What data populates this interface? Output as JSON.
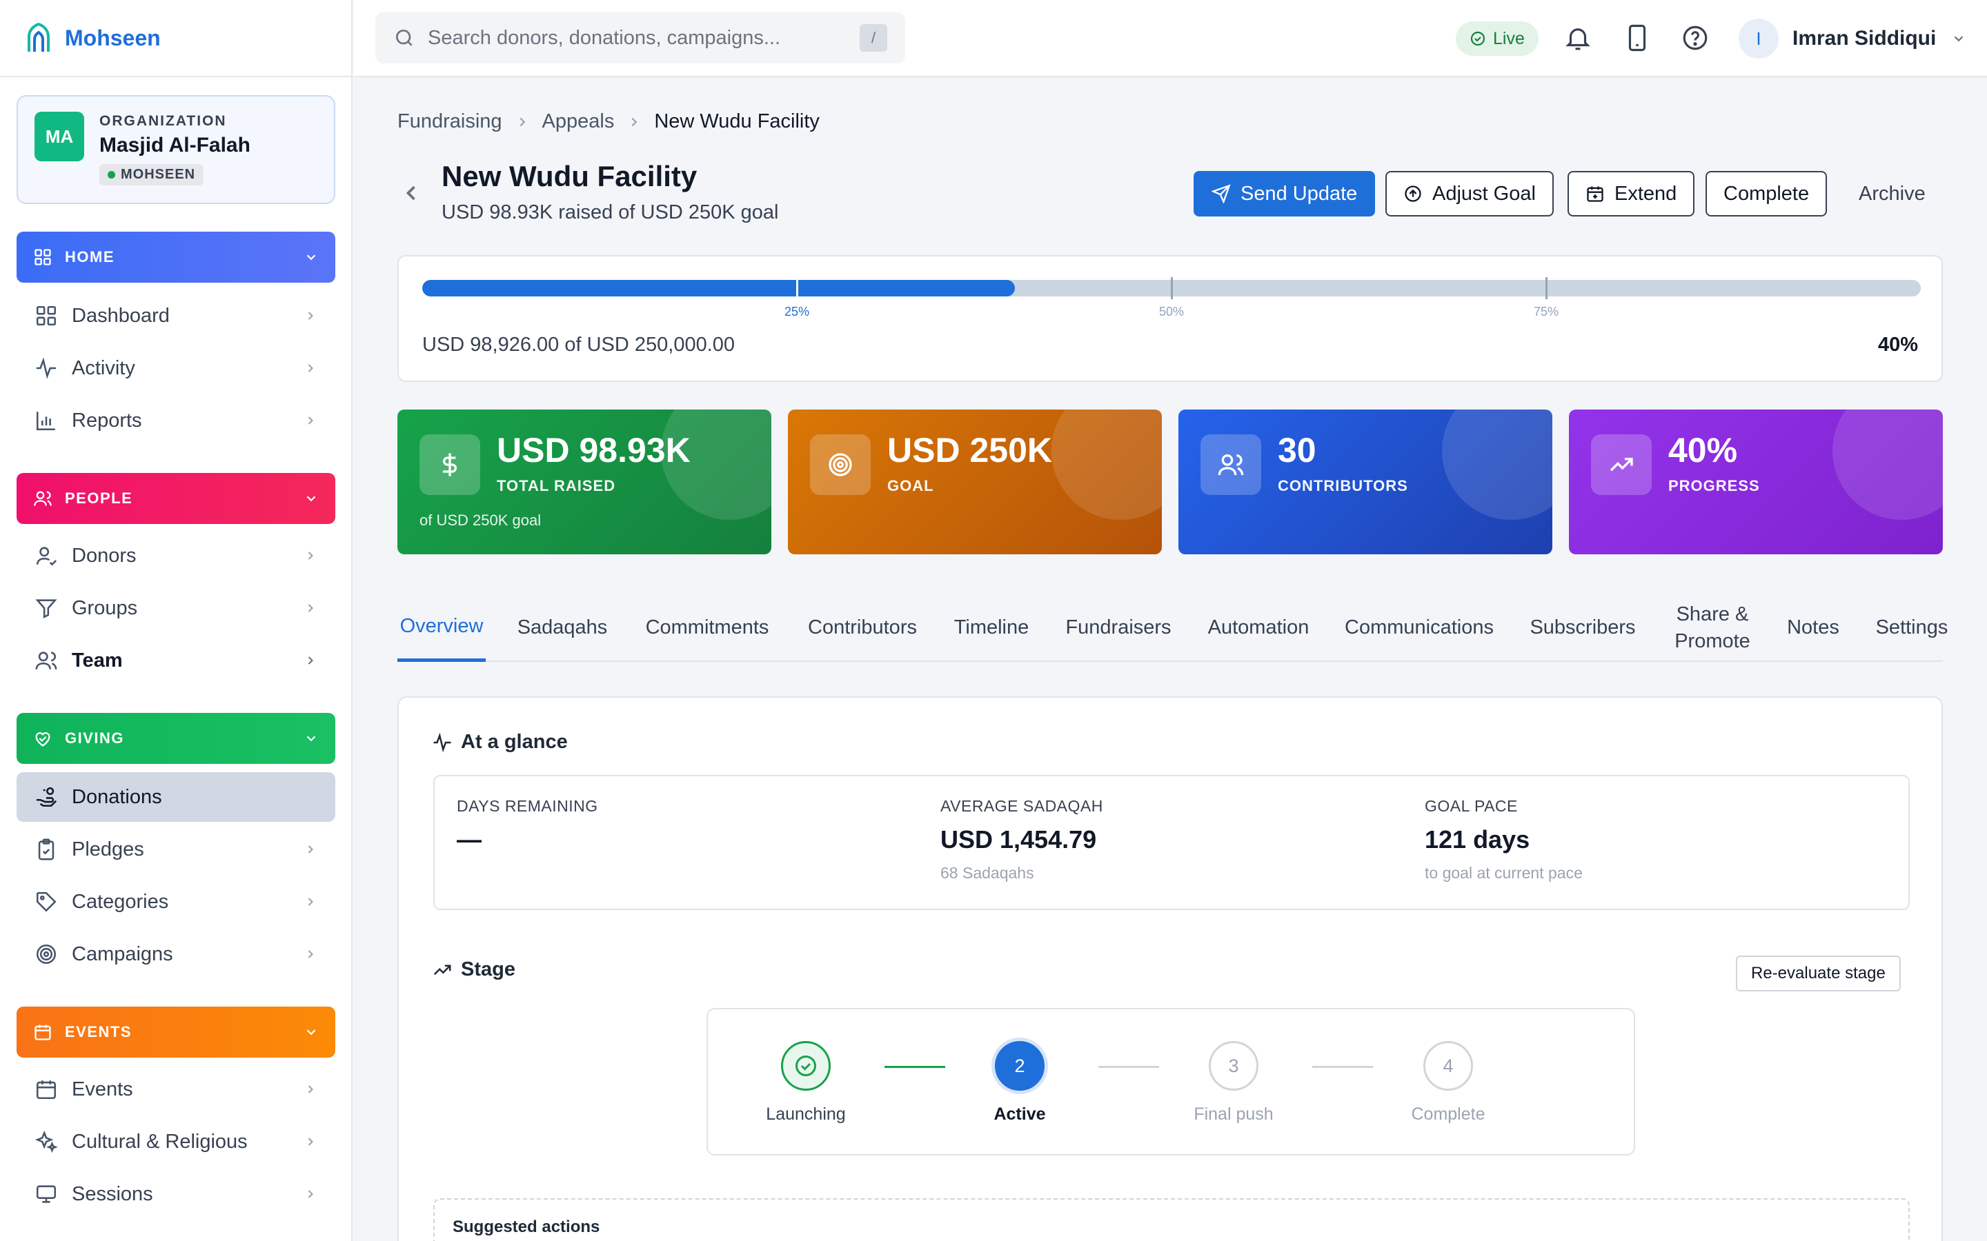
{
  "brand": {
    "name": "Mohseen"
  },
  "org": {
    "initials": "MA",
    "label": "ORGANIZATION",
    "name": "Masjid Al-Falah",
    "badge": "MOHSEEN"
  },
  "sidebar": {
    "home": {
      "label": "HOME",
      "color": "#4f6ef7",
      "items": [
        {
          "label": "Dashboard",
          "icon": "dashboard-icon"
        },
        {
          "label": "Activity",
          "icon": "activity-icon"
        },
        {
          "label": "Reports",
          "icon": "bar-chart-icon"
        }
      ]
    },
    "people": {
      "label": "PEOPLE",
      "color": "#f0106c",
      "items": [
        {
          "label": "Donors",
          "icon": "user-icon"
        },
        {
          "label": "Groups",
          "icon": "filter-icon"
        },
        {
          "label": "Team",
          "icon": "users-icon"
        }
      ]
    },
    "giving": {
      "label": "GIVING",
      "color": "#16b35a",
      "items": [
        {
          "label": "Donations",
          "icon": "hand-coins-icon"
        },
        {
          "label": "Pledges",
          "icon": "clipboard-icon"
        },
        {
          "label": "Categories",
          "icon": "tag-icon"
        },
        {
          "label": "Campaigns",
          "icon": "target-icon"
        }
      ]
    },
    "events": {
      "label": "EVENTS",
      "color": "#fb7a06",
      "items": [
        {
          "label": "Events",
          "icon": "calendar-icon"
        },
        {
          "label": "Cultural & Religious",
          "icon": "sparkles-icon"
        },
        {
          "label": "Sessions",
          "icon": "monitor-icon"
        }
      ]
    }
  },
  "topbar": {
    "search_placeholder": "Search donors, donations, campaigns...",
    "search_shortcut": "/",
    "live_label": "Live",
    "user_initial": "I",
    "user_name": "Imran Siddiqui"
  },
  "breadcrumb": [
    "Fundraising",
    "Appeals",
    "New Wudu Facility"
  ],
  "page": {
    "title": "New Wudu Facility",
    "subtitle": "USD 98.93K raised of USD 250K goal",
    "actions": {
      "send_update": "Send Update",
      "adjust_goal": "Adjust Goal",
      "extend": "Extend",
      "complete": "Complete",
      "archive": "Archive"
    }
  },
  "progress": {
    "fraction": 0.3957,
    "milestones": [
      "25%",
      "50%",
      "75%"
    ],
    "text": "USD 98,926.00 of USD 250,000.00",
    "percent_label": "40%"
  },
  "stats": [
    {
      "value": "USD 98.93K",
      "label": "TOTAL RAISED",
      "note": "of USD 250K goal",
      "icon": "dollar-icon",
      "color_from": "#16a34a",
      "color_to": "#15803d"
    },
    {
      "value": "USD 250K",
      "label": "GOAL",
      "note": "",
      "icon": "target-icon",
      "color_from": "#d97706",
      "color_to": "#b45309"
    },
    {
      "value": "30",
      "label": "CONTRIBUTORS",
      "note": "",
      "icon": "users-icon",
      "color_from": "#2563eb",
      "color_to": "#1e40af"
    },
    {
      "value": "40%",
      "label": "PROGRESS",
      "note": "",
      "icon": "trending-up-icon",
      "color_from": "#9333ea",
      "color_to": "#7e22ce"
    }
  ],
  "tabs": [
    "Overview",
    "Sadaqahs",
    "Commitments",
    "Contributors",
    "Timeline",
    "Fundraisers",
    "Automation",
    "Communications",
    "Subscribers",
    "Share & Promote",
    "Notes",
    "Settings"
  ],
  "glance": {
    "title": "At a glance",
    "cells": [
      {
        "label": "DAYS REMAINING",
        "value": "—",
        "sub": ""
      },
      {
        "label": "AVERAGE SADAQAH",
        "value": "USD 1,454.79",
        "sub": "68 Sadaqahs"
      },
      {
        "label": "GOAL PACE",
        "value": "121 days",
        "sub": "to goal at current pace"
      }
    ]
  },
  "stage": {
    "title": "Stage",
    "reevaluate": "Re-evaluate stage",
    "steps": [
      {
        "num": "1",
        "label": "Launching",
        "state": "done"
      },
      {
        "num": "2",
        "label": "Active",
        "state": "current"
      },
      {
        "num": "3",
        "label": "Final push",
        "state": "todo"
      },
      {
        "num": "4",
        "label": "Complete",
        "state": "todo"
      }
    ]
  },
  "suggested": {
    "title": "Suggested actions"
  }
}
